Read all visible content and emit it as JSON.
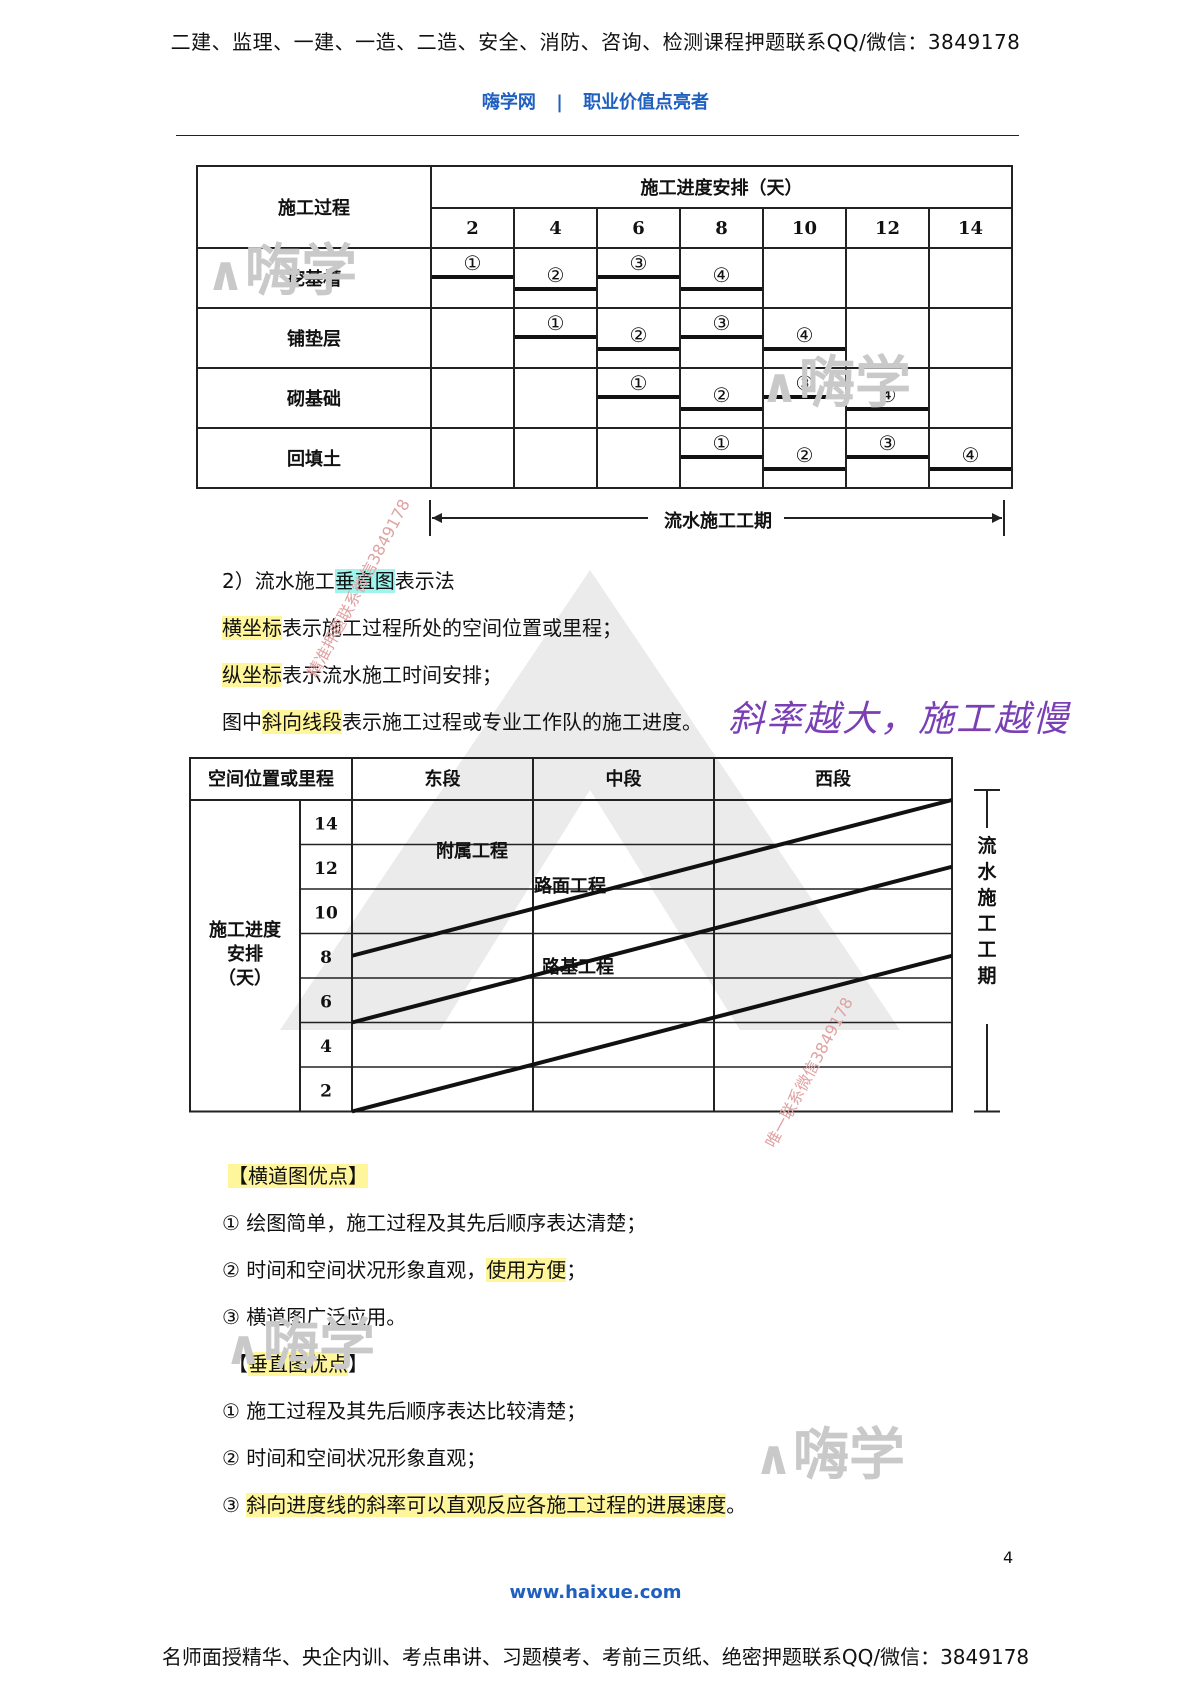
{
  "header": {
    "top_line": "二建、监理、一建、一造、二造、安全、消防、咨询、检测课程押题联系QQ/微信：3849178",
    "brand_left": "嗨学网",
    "brand_sep": "|",
    "brand_right": "职业价值点亮者"
  },
  "table1": {
    "col_process": "施工过程",
    "col_schedule": "施工进度安排（天）",
    "days": [
      "2",
      "4",
      "6",
      "8",
      "10",
      "12",
      "14"
    ],
    "rows": [
      {
        "name": "挖基槽",
        "marks": [
          "①",
          "②",
          "③",
          "④",
          "",
          "",
          ""
        ]
      },
      {
        "name": "铺垫层",
        "marks": [
          "",
          "①",
          "②",
          "③",
          "④",
          "",
          ""
        ]
      },
      {
        "name": "砌基础",
        "marks": [
          "",
          "",
          "①",
          "②",
          "③",
          "④",
          ""
        ]
      },
      {
        "name": "回填土",
        "marks": [
          "",
          "",
          "",
          "①",
          "②",
          "③",
          "④"
        ]
      }
    ],
    "period_label": "流水施工工期"
  },
  "section2": {
    "title_before": "2）流水施工",
    "title_hl": "垂直图",
    "title_after": "表示法",
    "line1_hl": "横坐标",
    "line1_rest": "表示施工过程所处的空间位置或里程；",
    "line2_hl": "纵坐标",
    "line2_rest": "表示流水施工时间安排；",
    "line3_before": "图中",
    "line3_hl": "斜向线段",
    "line3_rest": "表示施工过程或专业工作队的施工进度。",
    "handwritten_note": "斜率越大，施工越慢"
  },
  "table2": {
    "col_space": "空间位置或里程",
    "segments": [
      "东段",
      "中段",
      "西段"
    ],
    "ylabel_lines": [
      "施工进度",
      "安排",
      "（天）"
    ],
    "days": [
      "14",
      "12",
      "10",
      "8",
      "6",
      "4",
      "2"
    ],
    "line_labels": [
      "附属工程",
      "路面工程",
      "路基工程"
    ],
    "period_label_chars": [
      "流",
      "水",
      "施",
      "工",
      "工",
      "期"
    ]
  },
  "advantages": {
    "bar_title": "【横道图优点】",
    "bar_items": [
      {
        "mark": "①",
        "text": "绘图简单，施工过程及其先后顺序表达清楚；",
        "hl": ""
      },
      {
        "mark": "②",
        "text": "时间和空间状况形象直观，",
        "hl": "使用方便",
        "tail": "；"
      },
      {
        "mark": "③",
        "text": "横道图广泛应用。",
        "hl": ""
      }
    ],
    "vert_title_open": "【",
    "vert_title_hl": "垂直图优点",
    "vert_title_close": "】",
    "vert_items": [
      {
        "mark": "①",
        "text": "施工过程及其先后顺序表达比较清楚；"
      },
      {
        "mark": "②",
        "text": "时间和空间状况形象直观；"
      },
      {
        "mark": "③",
        "hl": "斜向进度线的斜率可以直观反应各施工过程的进展速度",
        "tail": "。"
      }
    ]
  },
  "watermarks": {
    "logo_text": "嗨学",
    "diag_text_1": "精准押题联系微信3849178",
    "diag_text_2": "唯一联系微信3849178"
  },
  "footer": {
    "page_number": "4",
    "url": "www.haixue.com",
    "bottom_line": "名师面授精华、央企内训、考点串讲、习题模考、考前三页纸、绝密押题联系QQ/微信：3849178"
  }
}
